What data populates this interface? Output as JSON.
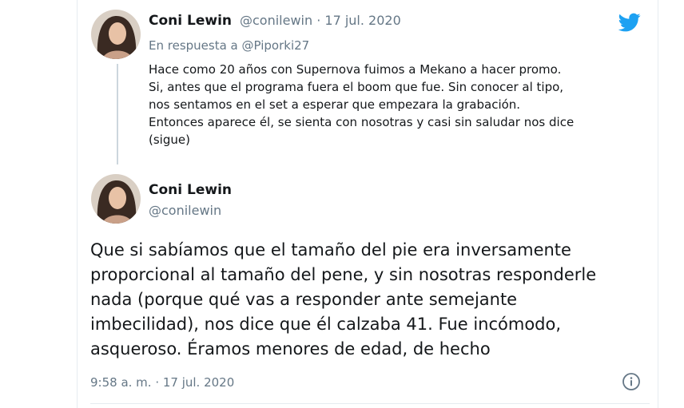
{
  "parent_tweet": {
    "author_name": "Coni Lewin",
    "author_meta": "@conilewin · 17 jul. 2020",
    "reply_prefix": "En respuesta a ",
    "reply_mention": "@Piporki27",
    "text_lines": [
      "Hace como 20 años con Supernova fuimos a Mekano a hacer promo.",
      "Si, antes que el programa fuera el boom que fue. Sin conocer al tipo,",
      "nos sentamos en el set a esperar que empezara la grabación.",
      "Entonces aparece él, se sienta con nosotras y casi sin saludar nos dice",
      "(sigue)"
    ]
  },
  "main_tweet": {
    "author_name": "Coni Lewin",
    "author_handle": "@conilewin",
    "text_lines": [
      "Que si sabíamos que el tamaño del pie era inversamente",
      "proporcional al tamaño del pene, y sin nosotras responderle",
      "nada (porque qué vas a responder ante semejante",
      "imbecilidad), nos dice que él calzaba 41. Fue incómodo,",
      "asqueroso. Éramos menores de edad, de hecho"
    ],
    "timestamp": "9:58 a. m. · 17 jul. 2020"
  },
  "icons": {
    "brand": "twitter-bird-icon",
    "info": "info-icon",
    "brand_color": "#1da1f2"
  }
}
